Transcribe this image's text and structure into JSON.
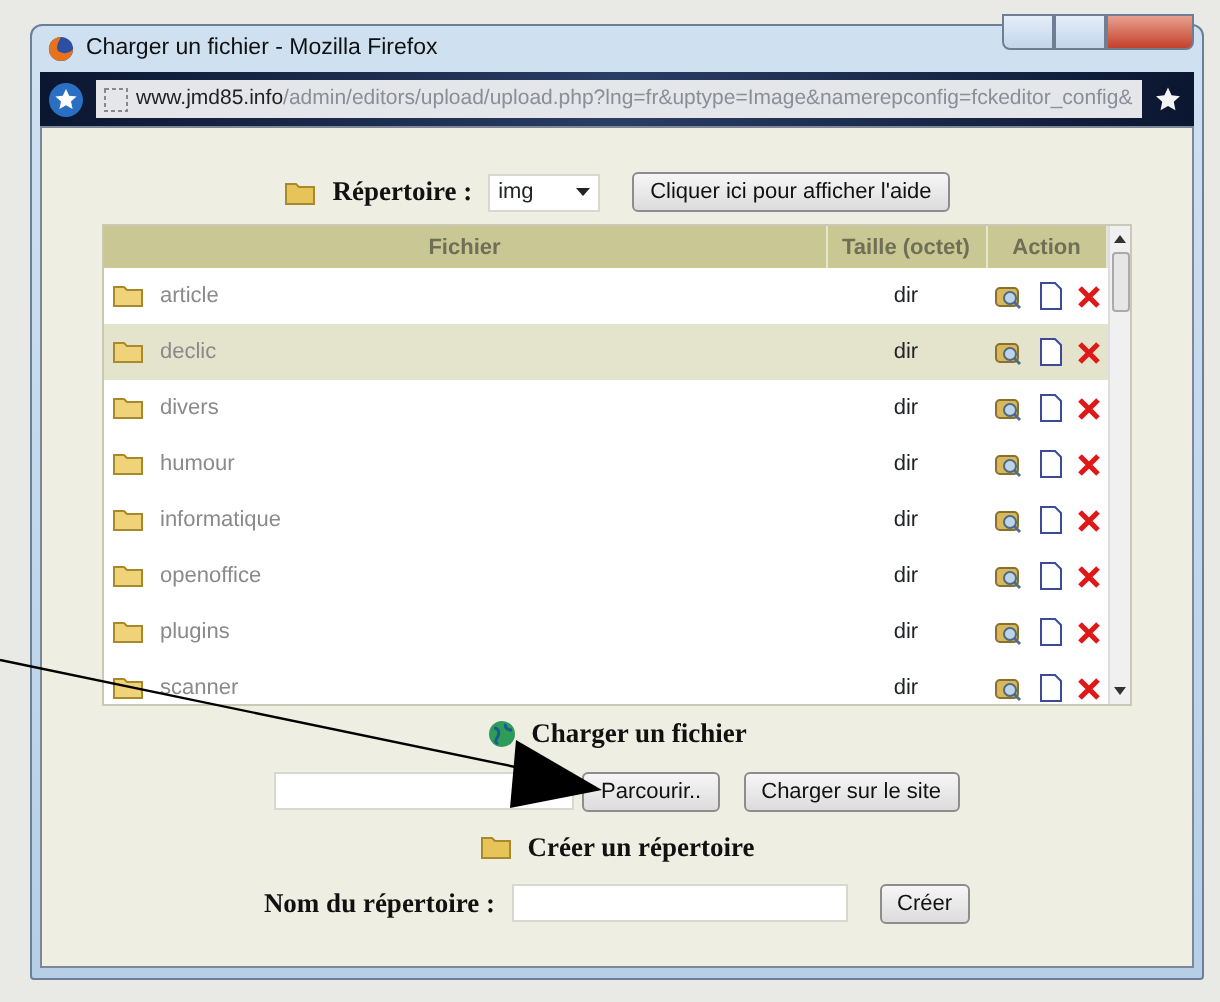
{
  "window": {
    "title": "Charger un fichier - Mozilla Firefox"
  },
  "address_bar": {
    "host": "www.jmd85.info",
    "path": "/admin/editors/upload/upload.php?lng=fr&uptype=Image&namerepconfig=fckeditor_config&"
  },
  "directory": {
    "label": "Répertoire :",
    "value": "img",
    "help_button": "Cliquer ici pour afficher l'aide"
  },
  "table": {
    "columns": [
      "Fichier",
      "Taille (octet)",
      "Action"
    ],
    "rows": [
      {
        "name": "article",
        "size": "dir",
        "selected": false
      },
      {
        "name": "declic",
        "size": "dir",
        "selected": true
      },
      {
        "name": "divers",
        "size": "dir",
        "selected": false
      },
      {
        "name": "humour",
        "size": "dir",
        "selected": false
      },
      {
        "name": "informatique",
        "size": "dir",
        "selected": false
      },
      {
        "name": "openoffice",
        "size": "dir",
        "selected": false
      },
      {
        "name": "plugins",
        "size": "dir",
        "selected": false
      },
      {
        "name": "scanner",
        "size": "dir",
        "selected": false
      }
    ]
  },
  "upload": {
    "heading": "Charger un fichier",
    "browse_button": "Parcourir..",
    "upload_button": "Charger sur le site"
  },
  "create": {
    "heading": "Créer un répertoire",
    "label": "Nom du répertoire :",
    "button": "Créer"
  }
}
